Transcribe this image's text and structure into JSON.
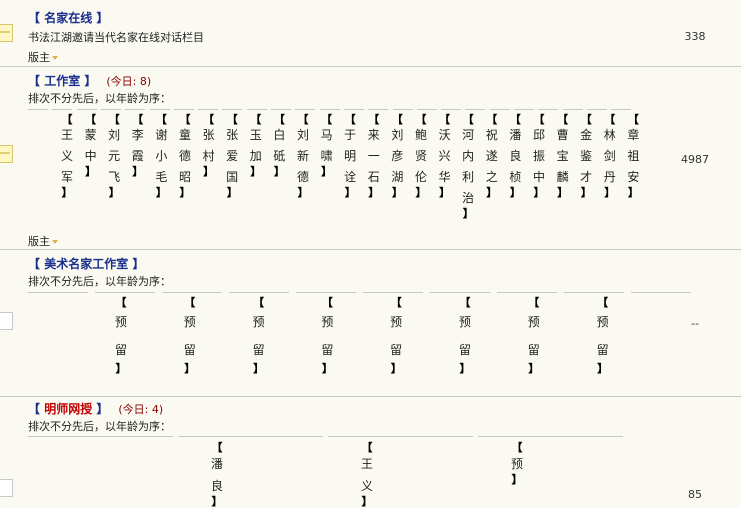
{
  "forums": [
    {
      "title": "名家在线",
      "description": "书法江湖邀请当代名家在线对话栏目",
      "moderator_label": "版主",
      "count": "338"
    },
    {
      "title": "工作室",
      "today": "(今日: 8)",
      "order_note": "排次不分先后，以年龄为序：",
      "moderator_label": "版主",
      "count": "4987",
      "members": [
        "王义军",
        "蒙中",
        "刘元飞",
        "李霞",
        "谢小毛",
        "童德昭",
        "张村",
        "张爱国",
        "玉加",
        "白砥",
        "刘新德",
        "马啸",
        "于明诠",
        "来一石",
        "刘彦湖",
        "鲍贤伦",
        "沃兴华",
        "河内利治",
        "祝遂之",
        "潘良桢",
        "邱振中",
        "曹宝麟",
        "金鉴才",
        "林剑丹",
        "章祖安"
      ]
    },
    {
      "title": "美术名家工作室",
      "order_note": "排次不分先后，以年龄为序：",
      "count": "--",
      "members": [
        "预留",
        "预留",
        "预留",
        "预留",
        "预留",
        "预留",
        "预留",
        "预留"
      ]
    },
    {
      "title": "明师网授",
      "today": "(今日: 4)",
      "order_note": "排次不分先后，以年龄为序：",
      "count": "85",
      "members": [
        "潘良",
        "王义",
        "预"
      ]
    }
  ]
}
